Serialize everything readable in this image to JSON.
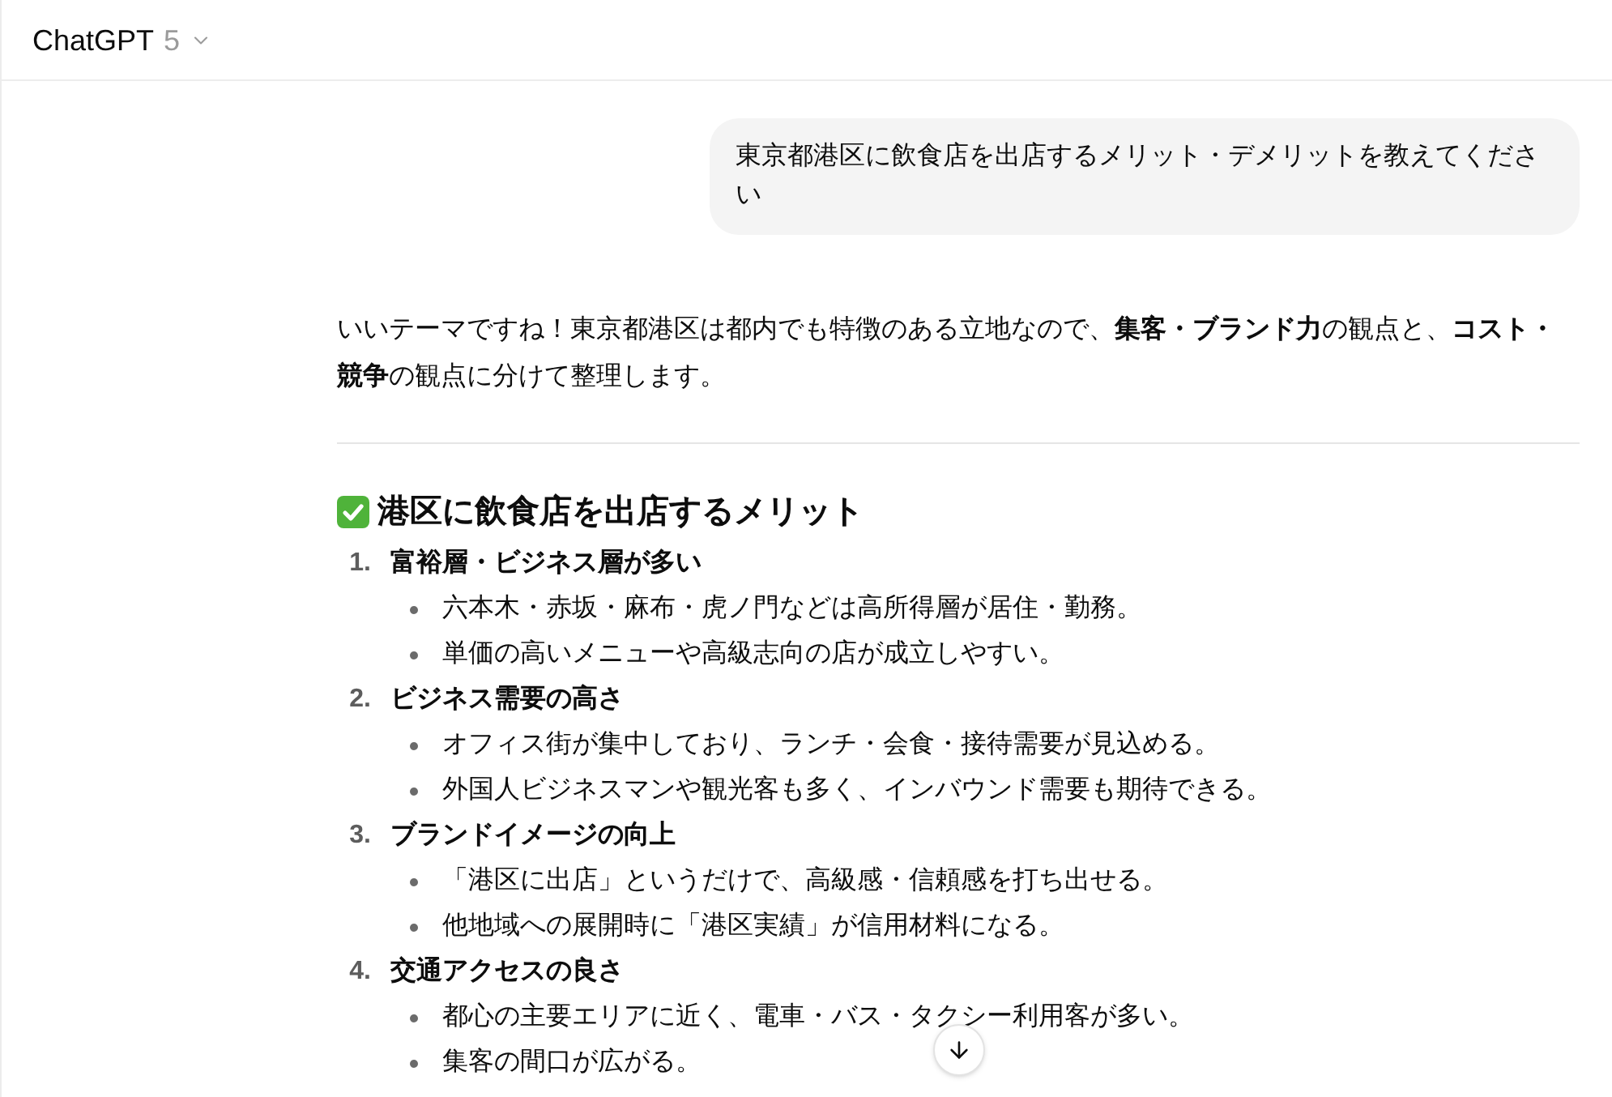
{
  "header": {
    "title": "ChatGPT",
    "version": "5"
  },
  "user_message": {
    "text": "東京都港区に飲食店を出店するメリット・デメリットを教えてください"
  },
  "assistant_message": {
    "intro": "いいテーマですね！東京都港区は都内でも特徴のある立地なので、**集客・ブランド力**の観点と、**コスト・競争**の観点に分けて整理します。",
    "sections": [
      {
        "heading": "港区に飲食店を出店するメリット",
        "items": [
          {
            "number": "1.",
            "title": "富裕層・ビジネス層が多い",
            "bullets": [
              "六本木・赤坂・麻布・虎ノ門などは高所得層が居住・勤務。",
              "単価の高いメニューや高級志向の店が成立しやすい。"
            ]
          },
          {
            "number": "2.",
            "title": "ビジネス需要の高さ",
            "bullets": [
              "オフィス街が集中しており、ランチ・会食・接待需要が見込める。",
              "外国人ビジネスマンや観光客も多く、インバウンド需要も期待できる。"
            ]
          },
          {
            "number": "3.",
            "title": "ブランドイメージの向上",
            "bullets": [
              "「港区に出店」というだけで、高級感・信頼感を打ち出せる。",
              "他地域への展開時に「港区実績」が信用材料になる。"
            ]
          },
          {
            "number": "4.",
            "title": "交通アクセスの良さ",
            "bullets": [
              "都心の主要エリアに近く、電車・バス・タクシー利用客が多い。",
              "集客の間口が広がる。"
            ]
          }
        ]
      }
    ]
  }
}
